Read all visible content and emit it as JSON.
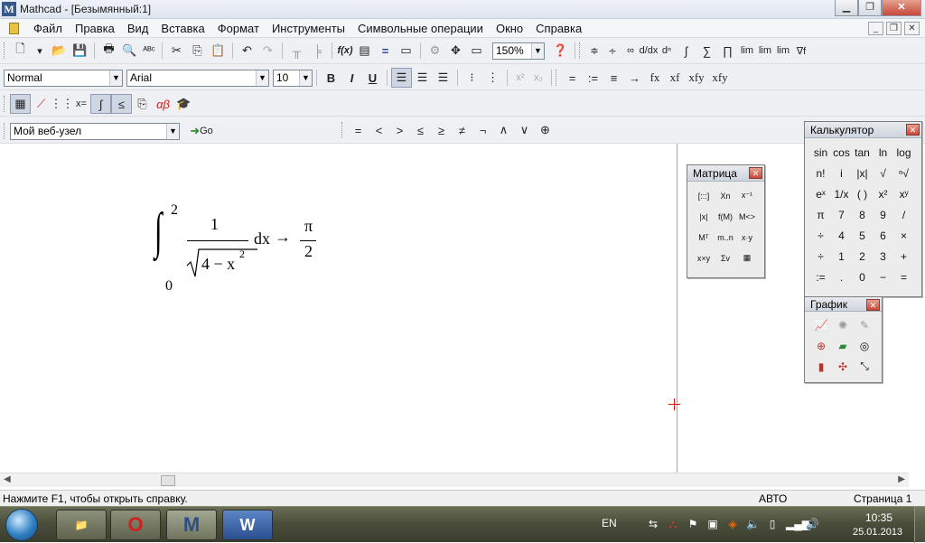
{
  "window": {
    "title": "Mathcad - [Безымянный:1]",
    "app_icon": "M"
  },
  "menu": {
    "items": [
      "Файл",
      "Правка",
      "Вид",
      "Вставка",
      "Формат",
      "Инструменты",
      "Символьные операции",
      "Окно",
      "Справка"
    ]
  },
  "toolbar": {
    "zoom_value": "150%",
    "style_value": "Normal",
    "font_value": "Arial",
    "size_value": "10",
    "bold_label": "B",
    "italic_label": "I",
    "underline_label": "U",
    "web_node_value": "Мой веб-узел",
    "go_label": "Go",
    "fx_labels": [
      "fx",
      "xf",
      "xfy",
      "xfy"
    ],
    "bool_ops": [
      "=",
      "<",
      ">",
      "≤",
      "≥",
      "≠",
      "¬",
      "∧",
      "∨",
      "⊕"
    ],
    "assign_ops": [
      "=",
      ":=",
      "≡",
      "→"
    ]
  },
  "math": {
    "upper": "2",
    "lower": "0",
    "numerator": "1",
    "radicand": "4 − x",
    "exponent": "2",
    "differential": "dx",
    "arrow": "→",
    "result_num": "π",
    "result_den": "2"
  },
  "calculator": {
    "title": "Калькулятор",
    "buttons": [
      "sin",
      "cos",
      "tan",
      "ln",
      "log",
      "n!",
      "i",
      "|x|",
      "√",
      "ⁿ√",
      "eˣ",
      "1/x",
      "( )",
      "x²",
      "xʸ",
      "π",
      "7",
      "8",
      "9",
      "/",
      "÷",
      "4",
      "5",
      "6",
      "×",
      "÷",
      "1",
      "2",
      "3",
      "+",
      ":=",
      ".",
      "0",
      "−",
      "="
    ]
  },
  "matrix": {
    "title": "Матрица",
    "buttons": [
      "[:::]",
      "Xn",
      "x⁻¹",
      "|x|",
      "f(M)",
      "M<>",
      "Mᵀ",
      "m..n",
      "x·y",
      "x×y",
      "Σv",
      "▦"
    ]
  },
  "graph": {
    "title": "График",
    "buttons": [
      "xy",
      "polar",
      "surf",
      "contour",
      "3D",
      "vector",
      "bar",
      "scatter",
      "pts"
    ]
  },
  "status": {
    "help": "Нажмите F1, чтобы открыть справку.",
    "mode": "АВТО",
    "page": "Страница 1"
  },
  "taskbar": {
    "lang": "EN",
    "time": "10:35",
    "date": "25.01.2013",
    "apps": [
      "Explorer",
      "O",
      "M",
      "W"
    ]
  },
  "colors": {
    "cursor": "#dd1111",
    "taskbar": "#4b4e3b"
  }
}
